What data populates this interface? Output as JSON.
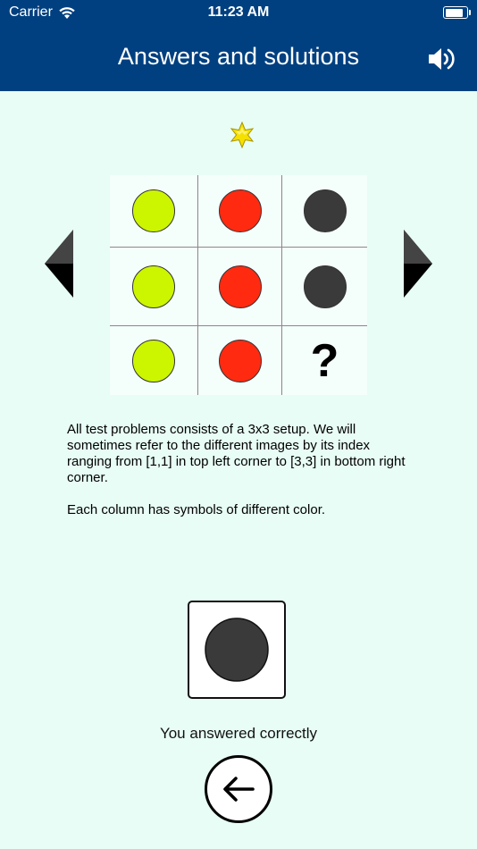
{
  "status_bar": {
    "carrier": "Carrier",
    "time": "11:23 AM",
    "battery_level": 0.92
  },
  "nav": {
    "title": "Answers and solutions",
    "sound_icon": "speaker-icon"
  },
  "colors": {
    "header_bg": "#004080",
    "page_bg": "#e8fdf5",
    "green": "#ccf500",
    "red": "#ff2a10",
    "dark": "#3a3a3a",
    "star": "#f5e000"
  },
  "puzzle": {
    "rows": [
      [
        {
          "kind": "dot",
          "color": "#ccf500"
        },
        {
          "kind": "dot",
          "color": "#ff2a10"
        },
        {
          "kind": "dot",
          "color": "#3a3a3a"
        }
      ],
      [
        {
          "kind": "dot",
          "color": "#ccf500"
        },
        {
          "kind": "dot",
          "color": "#ff2a10"
        },
        {
          "kind": "dot",
          "color": "#3a3a3a"
        }
      ],
      [
        {
          "kind": "dot",
          "color": "#ccf500"
        },
        {
          "kind": "dot",
          "color": "#ff2a10"
        },
        {
          "kind": "question",
          "text": "?"
        }
      ]
    ]
  },
  "description": {
    "paragraph1": "All test problems consists of a 3x3 setup. We will sometimes refer to the different images by its index ranging from [1,1] in top left corner to [3,3] in bottom right corner.",
    "paragraph2": "Each column has symbols of different color."
  },
  "answer": {
    "color": "#3a3a3a"
  },
  "result_text": "You answered correctly"
}
